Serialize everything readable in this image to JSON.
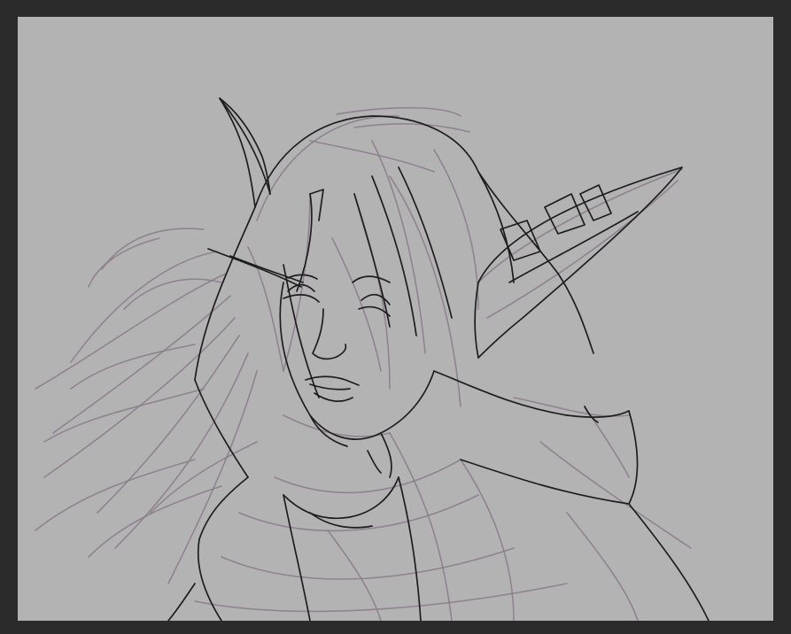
{
  "canvas": {
    "background_color": "#b3b3b3",
    "workspace_color": "#2b2b2b",
    "sketch_rough_color": "#8a7a8a",
    "sketch_ink_color": "#1e1e1e"
  }
}
